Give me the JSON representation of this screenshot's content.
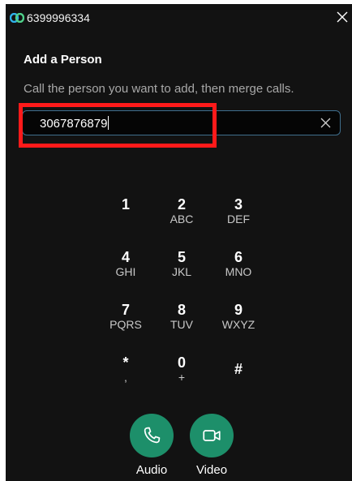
{
  "window": {
    "title": "6399996334"
  },
  "dialog": {
    "heading": "Add a Person",
    "subtitle": "Call the person you want to add, then merge calls."
  },
  "input": {
    "value": "3067876879"
  },
  "keypad": {
    "keys": [
      {
        "digit": "1",
        "letters": ""
      },
      {
        "digit": "2",
        "letters": "ABC"
      },
      {
        "digit": "3",
        "letters": "DEF"
      },
      {
        "digit": "4",
        "letters": "GHI"
      },
      {
        "digit": "5",
        "letters": "JKL"
      },
      {
        "digit": "6",
        "letters": "MNO"
      },
      {
        "digit": "7",
        "letters": "PQRS"
      },
      {
        "digit": "8",
        "letters": "TUV"
      },
      {
        "digit": "9",
        "letters": "WXYZ"
      },
      {
        "digit": "*",
        "letters": ","
      },
      {
        "digit": "0",
        "letters": "+"
      },
      {
        "digit": "#",
        "letters": ""
      }
    ]
  },
  "actions": {
    "audio_label": "Audio",
    "video_label": "Video"
  },
  "colors": {
    "background": "#121212",
    "call_button": "#1d8f6a",
    "highlight": "#ff1a1a",
    "input_border": "#3f6e8d"
  },
  "icons": {
    "app": "webex-logo-icon",
    "close": "close-icon",
    "clear": "clear-input-icon",
    "audio": "phone-icon",
    "video": "video-camera-icon"
  }
}
